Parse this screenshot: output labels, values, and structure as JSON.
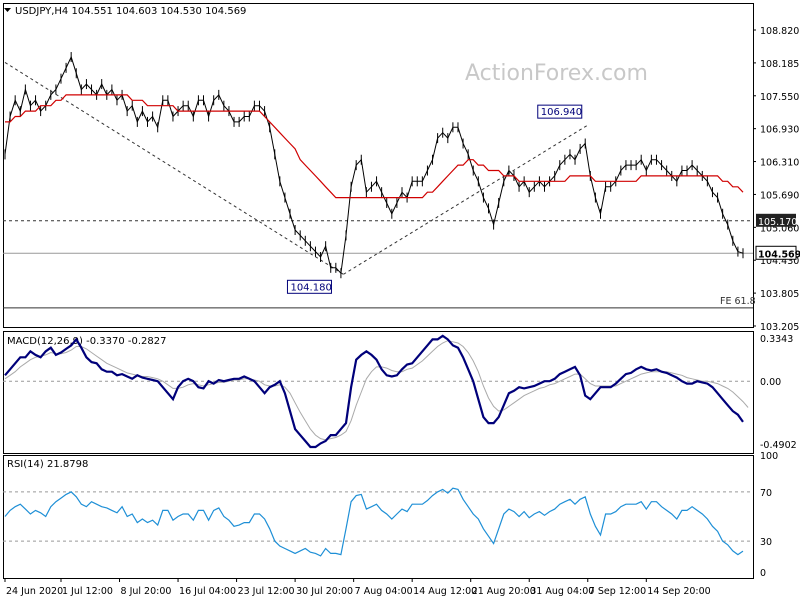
{
  "chart_data": {
    "type": "line",
    "instrument": {
      "symbol_tf": "USDJPY,H4",
      "open": "104.551",
      "high": "104.603",
      "low": "104.530",
      "close": "104.569"
    },
    "watermark": "ActionForex.com",
    "price_panel": {
      "ylim": [
        103.205,
        109.2
      ],
      "y_ticks": [
        "108.820",
        "108.185",
        "107.550",
        "106.930",
        "106.310",
        "105.690",
        "105.060",
        "104.430",
        "103.805",
        "103.205"
      ],
      "current_price": "104.569",
      "level_label": "105.170",
      "fe_label": "FE 61.8",
      "fe_value": 103.56,
      "annotations": [
        {
          "label": "104.180",
          "x": 66.5,
          "y": 104.18
        },
        {
          "label": "106.940",
          "x": 114.5,
          "y": 106.94
        }
      ],
      "trend_lines": [
        {
          "x": [
            0,
            66.5
          ],
          "y": [
            108.1,
            104.18
          ]
        },
        {
          "x": [
            66.5,
            114.5
          ],
          "y": [
            104.18,
            106.94
          ]
        }
      ],
      "series": [
        {
          "values": [
            106.4,
            107.1,
            107.4,
            107.2,
            107.6,
            107.3,
            107.4,
            107.2,
            107.3,
            107.5,
            107.6,
            107.8,
            108.0,
            108.2,
            107.9,
            107.6,
            107.7,
            107.6,
            107.5,
            107.7,
            107.5,
            107.6,
            107.4,
            107.5,
            107.2,
            107.3,
            107.0,
            107.2,
            107.0,
            107.1,
            106.9,
            107.4,
            107.4,
            107.1,
            107.2,
            107.3,
            107.3,
            107.1,
            107.4,
            107.4,
            107.1,
            107.4,
            107.5,
            107.3,
            107.2,
            107.0,
            107.0,
            107.1,
            107.1,
            107.3,
            107.3,
            107.2,
            106.9,
            106.4,
            105.9,
            105.6,
            105.3,
            105.0,
            104.9,
            104.8,
            104.7,
            104.6,
            104.5,
            104.7,
            104.3,
            104.3,
            104.2,
            104.9,
            105.8,
            106.2,
            106.3,
            105.7,
            105.8,
            105.9,
            105.7,
            105.5,
            105.3,
            105.5,
            105.7,
            105.6,
            105.9,
            105.9,
            105.9,
            106.1,
            106.3,
            106.7,
            106.8,
            106.7,
            106.9,
            106.9,
            106.6,
            106.4,
            106.1,
            105.9,
            105.6,
            105.4,
            105.1,
            105.5,
            105.9,
            106.1,
            106.0,
            105.8,
            105.9,
            105.7,
            105.8,
            105.9,
            105.8,
            105.9,
            106.0,
            106.2,
            106.3,
            106.4,
            106.3,
            106.5,
            106.6,
            106.0,
            105.6,
            105.3,
            105.8,
            105.8,
            105.9,
            106.1,
            106.2,
            106.2,
            106.2,
            106.3,
            106.1,
            106.3,
            106.3,
            106.2,
            106.1,
            106.0,
            105.9,
            106.1,
            106.1,
            106.2,
            106.1,
            106.0,
            105.9,
            105.7,
            105.6,
            105.3,
            105.1,
            104.8,
            104.6,
            104.57
          ]
        },
        {
          "values": [
            107.0,
            107.0,
            107.1,
            107.1,
            107.2,
            107.2,
            107.2,
            107.3,
            107.3,
            107.3,
            107.4,
            107.4,
            107.5,
            107.5,
            107.5,
            107.5,
            107.5,
            107.5,
            107.5,
            107.5,
            107.5,
            107.5,
            107.5,
            107.5,
            107.5,
            107.4,
            107.4,
            107.4,
            107.3,
            107.3,
            107.3,
            107.3,
            107.3,
            107.3,
            107.2,
            107.2,
            107.2,
            107.2,
            107.2,
            107.2,
            107.2,
            107.2,
            107.2,
            107.2,
            107.2,
            107.2,
            107.2,
            107.2,
            107.2,
            107.2,
            107.2,
            107.1,
            107.0,
            106.9,
            106.8,
            106.7,
            106.6,
            106.5,
            106.3,
            106.2,
            106.1,
            106.0,
            105.9,
            105.8,
            105.7,
            105.6,
            105.6,
            105.6,
            105.6,
            105.6,
            105.6,
            105.6,
            105.6,
            105.6,
            105.6,
            105.6,
            105.6,
            105.6,
            105.6,
            105.6,
            105.6,
            105.6,
            105.6,
            105.7,
            105.7,
            105.8,
            105.9,
            106.0,
            106.1,
            106.2,
            106.2,
            106.3,
            106.3,
            106.2,
            106.2,
            106.1,
            106.1,
            106.1,
            106.0,
            106.0,
            106.0,
            105.9,
            105.9,
            105.9,
            105.9,
            105.9,
            105.9,
            105.9,
            105.9,
            105.9,
            105.9,
            106.0,
            106.0,
            106.0,
            106.0,
            106.0,
            105.9,
            105.9,
            105.9,
            105.9,
            105.9,
            105.9,
            105.9,
            105.9,
            105.9,
            106.0,
            106.0,
            106.0,
            106.0,
            106.0,
            106.0,
            106.0,
            106.0,
            106.0,
            106.0,
            106.0,
            106.0,
            106.0,
            106.0,
            106.0,
            106.0,
            105.9,
            105.9,
            105.8,
            105.8,
            105.7
          ]
        }
      ]
    },
    "macd_panel": {
      "label": "MACD(12,26,9) -0.3370 -0.2827",
      "ylim": [
        -0.6,
        0.42
      ],
      "ticks": [
        "0.3343",
        "0.00",
        "-0.4902"
      ],
      "series": [
        {
          "values": [
            0.05,
            0.1,
            0.15,
            0.2,
            0.2,
            0.25,
            0.22,
            0.2,
            0.25,
            0.28,
            0.22,
            0.24,
            0.27,
            0.3,
            0.35,
            0.28,
            0.2,
            0.16,
            0.15,
            0.1,
            0.08,
            0.08,
            0.05,
            0.06,
            0.04,
            0.02,
            0.05,
            0.03,
            0.02,
            0.01,
            0.0,
            -0.05,
            -0.1,
            -0.15,
            -0.05,
            0.0,
            0.02,
            0.0,
            -0.05,
            -0.06,
            0.0,
            -0.02,
            0.01,
            0.0,
            0.01,
            0.02,
            0.02,
            0.04,
            0.02,
            0.0,
            -0.05,
            -0.1,
            -0.05,
            -0.03,
            0.0,
            -0.1,
            -0.25,
            -0.4,
            -0.45,
            -0.5,
            -0.55,
            -0.55,
            -0.52,
            -0.5,
            -0.45,
            -0.45,
            -0.4,
            -0.35,
            -0.05,
            0.18,
            0.22,
            0.25,
            0.22,
            0.18,
            0.1,
            0.05,
            0.04,
            0.05,
            0.1,
            0.14,
            0.15,
            0.2,
            0.25,
            0.3,
            0.35,
            0.35,
            0.38,
            0.35,
            0.3,
            0.28,
            0.2,
            0.1,
            0.0,
            -0.15,
            -0.3,
            -0.35,
            -0.35,
            -0.3,
            -0.2,
            -0.1,
            -0.08,
            -0.05,
            -0.06,
            -0.05,
            -0.04,
            -0.02,
            0.0,
            0.0,
            0.02,
            0.06,
            0.08,
            0.1,
            0.12,
            0.05,
            -0.12,
            -0.15,
            -0.1,
            -0.05,
            -0.05,
            -0.05,
            -0.02,
            0.02,
            0.06,
            0.07,
            0.1,
            0.12,
            0.1,
            0.09,
            0.1,
            0.08,
            0.07,
            0.05,
            0.03,
            0.0,
            -0.02,
            -0.02,
            0.0,
            -0.01,
            -0.02,
            -0.05,
            -0.1,
            -0.15,
            -0.2,
            -0.25,
            -0.28,
            -0.34
          ]
        },
        {
          "values": [
            0.02,
            0.05,
            0.08,
            0.12,
            0.15,
            0.18,
            0.2,
            0.21,
            0.22,
            0.24,
            0.23,
            0.23,
            0.24,
            0.26,
            0.29,
            0.29,
            0.27,
            0.24,
            0.21,
            0.18,
            0.15,
            0.13,
            0.11,
            0.09,
            0.07,
            0.06,
            0.05,
            0.04,
            0.04,
            0.03,
            0.02,
            0.0,
            -0.03,
            -0.06,
            -0.06,
            -0.05,
            -0.03,
            -0.02,
            -0.03,
            -0.04,
            -0.03,
            -0.02,
            -0.01,
            -0.01,
            0.0,
            0.01,
            0.01,
            0.02,
            0.02,
            0.01,
            0.0,
            -0.03,
            -0.04,
            -0.04,
            -0.03,
            -0.05,
            -0.1,
            -0.18,
            -0.26,
            -0.33,
            -0.4,
            -0.45,
            -0.48,
            -0.49,
            -0.48,
            -0.47,
            -0.45,
            -0.42,
            -0.33,
            -0.2,
            -0.09,
            0.02,
            0.08,
            0.12,
            0.12,
            0.11,
            0.09,
            0.08,
            0.08,
            0.1,
            0.11,
            0.14,
            0.17,
            0.21,
            0.25,
            0.29,
            0.32,
            0.34,
            0.33,
            0.32,
            0.29,
            0.24,
            0.17,
            0.08,
            -0.04,
            -0.14,
            -0.21,
            -0.25,
            -0.24,
            -0.21,
            -0.18,
            -0.15,
            -0.12,
            -0.1,
            -0.08,
            -0.06,
            -0.05,
            -0.03,
            -0.02,
            0.0,
            0.02,
            0.04,
            0.06,
            0.06,
            0.02,
            -0.02,
            -0.04,
            -0.04,
            -0.04,
            -0.04,
            -0.04,
            -0.02,
            0.0,
            0.02,
            0.04,
            0.06,
            0.07,
            0.08,
            0.08,
            0.08,
            0.08,
            0.07,
            0.06,
            0.05,
            0.03,
            0.02,
            0.01,
            0.0,
            0.0,
            -0.01,
            -0.02,
            -0.04,
            -0.06,
            -0.09,
            -0.13,
            -0.17,
            -0.22
          ]
        }
      ]
    },
    "rsi_panel": {
      "label": "RSI(14) 21.8798",
      "ylim": [
        0,
        100
      ],
      "ticks": [
        "100",
        "70",
        "30",
        "0"
      ],
      "levels": [
        70,
        30
      ],
      "values": [
        50,
        55,
        58,
        60,
        56,
        52,
        55,
        53,
        50,
        58,
        62,
        65,
        68,
        70,
        66,
        60,
        58,
        62,
        60,
        58,
        57,
        55,
        53,
        58,
        50,
        52,
        45,
        48,
        45,
        47,
        43,
        55,
        55,
        47,
        50,
        52,
        52,
        47,
        55,
        55,
        47,
        55,
        57,
        50,
        47,
        42,
        43,
        45,
        45,
        52,
        52,
        48,
        40,
        30,
        26,
        24,
        22,
        20,
        22,
        24,
        21,
        20,
        18,
        24,
        20,
        20,
        19,
        40,
        62,
        67,
        68,
        56,
        58,
        60,
        55,
        52,
        48,
        52,
        56,
        54,
        60,
        60,
        60,
        63,
        67,
        70,
        72,
        69,
        73,
        72,
        64,
        58,
        52,
        48,
        40,
        34,
        28,
        40,
        52,
        56,
        54,
        50,
        54,
        49,
        52,
        54,
        51,
        54,
        56,
        60,
        62,
        64,
        60,
        64,
        66,
        52,
        42,
        35,
        52,
        52,
        54,
        58,
        60,
        60,
        60,
        62,
        56,
        62,
        62,
        58,
        55,
        52,
        48,
        55,
        55,
        58,
        55,
        52,
        48,
        42,
        38,
        30,
        27,
        22,
        19,
        21.88
      ]
    },
    "x_ticks": [
      {
        "label": "24 Jun 2020",
        "x": 0
      },
      {
        "label": "1 Jul 12:00",
        "x": 11
      },
      {
        "label": "8 Jul 20:00",
        "x": 22.5
      },
      {
        "label": "16 Jul 04:00",
        "x": 34
      },
      {
        "label": "23 Jul 12:00",
        "x": 45.5
      },
      {
        "label": "30 Jul 20:00",
        "x": 57
      },
      {
        "label": "7 Aug 04:00",
        "x": 68.5
      },
      {
        "label": "14 Aug 12:00",
        "x": 80
      },
      {
        "label": "21 Aug 20:00",
        "x": 91.5
      },
      {
        "label": "31 Aug 04:00",
        "x": 103
      },
      {
        "label": "7 Sep 12:00",
        "x": 114.5
      },
      {
        "label": "14 Sep 20:00",
        "x": 126
      }
    ]
  }
}
